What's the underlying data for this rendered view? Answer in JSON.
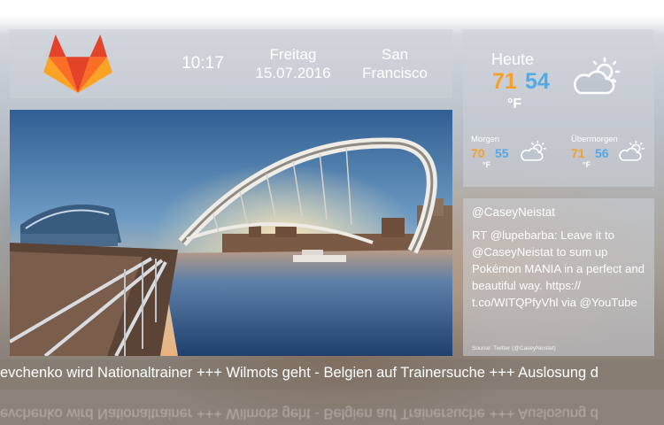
{
  "header": {
    "time": "10:17",
    "weekday": "Freitag",
    "date": "15.07.2016",
    "city_line1": "San",
    "city_line2": "Francisco",
    "logo_icon": "gitlab-fox-logo"
  },
  "weather": {
    "today": {
      "label": "Heute",
      "high": "71",
      "low": "54",
      "unit": "°F",
      "icon": "partly-cloudy-icon"
    },
    "tomorrow": {
      "label": "Morgen",
      "high": "70",
      "low": "55",
      "unit": "°F",
      "icon": "partly-cloudy-icon"
    },
    "day_after": {
      "label": "Übermorgen",
      "high": "71",
      "low": "56",
      "unit": "°F",
      "icon": "partly-cloudy-icon"
    },
    "colors": {
      "high": "#f3a02c",
      "low": "#52a9e6"
    }
  },
  "tweet": {
    "handle": "@CaseyNeistat",
    "text": "RT @lupebarba: Leave it to @CaseyNeistat to sum up Pokémon MANIA in a perfect and beautiful way. https:// t.co/WITQPfyVhl via @YouTube",
    "source": "Source: Twitter (@CaseyNeistat)"
  },
  "ticker": {
    "text": "evchenko wird Nationaltrainer   +++   Wilmots geht - Belgien auf Trainersuche   +++   Auslosung d"
  }
}
